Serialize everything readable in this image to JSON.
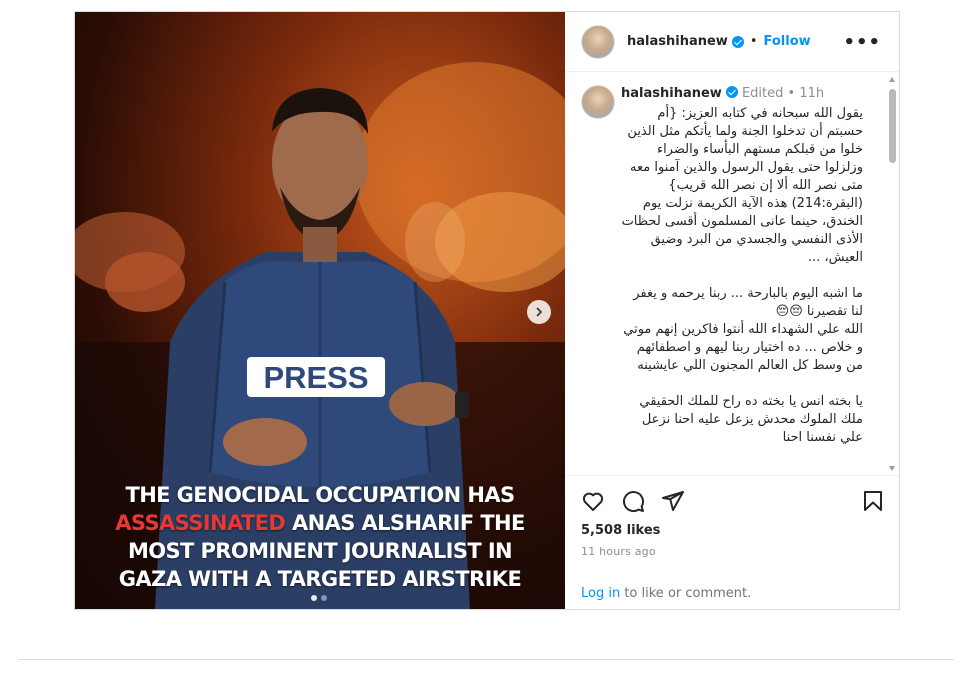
{
  "post": {
    "username": "halashihanew",
    "follow_label": "Follow",
    "separator": "•",
    "more_label": "•••"
  },
  "media": {
    "press_text": "PRESS",
    "overlay": {
      "line1": "THE GENOCIDAL OCCUPATION HAS",
      "line2_red": "ASSASSINATED",
      "line2_rest": " ANAS ALSHARIF THE",
      "line3": "MOST PROMINENT JOURNALIST IN",
      "line4": "GAZA WITH A TARGETED AIRSTRIKE"
    },
    "slide_count": 2,
    "active_slide": 1
  },
  "caption": {
    "username": "halashihanew",
    "edited_label": "Edited",
    "separator": "•",
    "age": "11h",
    "paragraphs": [
      "يقول الله سبحانه في كتابه العزيز: {أم حسبتم أن تدخلوا الجنة ولما يأتكم مثل الذين خلوا من قبلكم مستهم البأساء والضراء وزلزلوا حتى يقول الرسول والذين آمنوا معه متى نصر الله ألا إن نصر الله قريب} (البقرة:214) هذه الآية الكريمة نزلت يوم الخندق، حينما عانى المسلمون أقسى لحظات الأذى النفسي والجسدي من البرد وضيق العيش، ...",
      "ما اشبه اليوم بالبارحة ... ربنا يرحمه و يغفر لنا تقصيرنا 😔😔\nالله علي الشهداء الله أنتوا فاكرين إنهم موتي و خلاص ... ده اختيار ربنا ليهم و اصطفائهم من وسط كل العالم المجنون اللي عايشينه",
      "يا بخته انس يا بخته ده راح للملك الحقيقي ملك الملوك محدش يزعل عليه احنا نزعل علي نفسنا احنا"
    ]
  },
  "engagement": {
    "likes": "5,508 likes",
    "time": "11 hours ago",
    "login_link": "Log in",
    "login_rest": " to like or comment."
  },
  "colors": {
    "accent": "#0095f6",
    "overlay_red": "#e53935",
    "vest": "#2f4a7a"
  },
  "icons": [
    "verified-badge-icon",
    "more-options-icon",
    "next-slide-icon",
    "heart-icon",
    "comment-icon",
    "share-icon",
    "bookmark-icon"
  ]
}
